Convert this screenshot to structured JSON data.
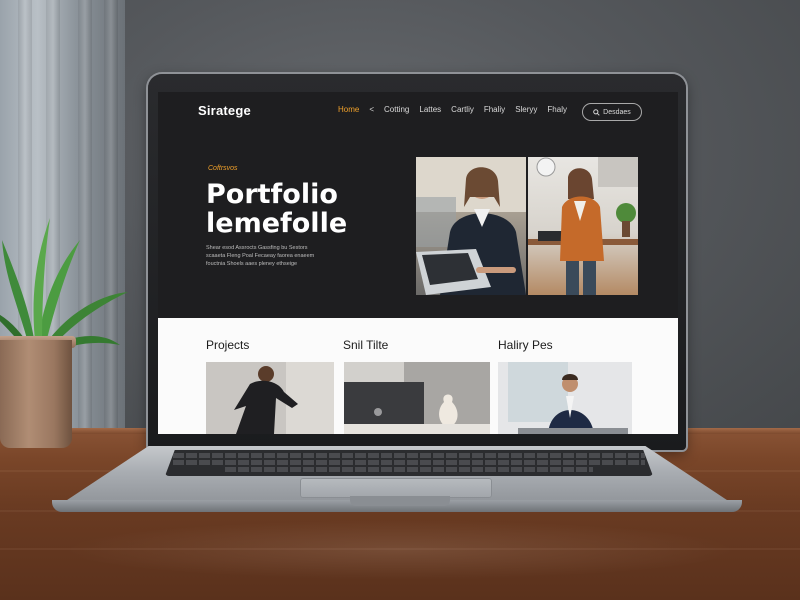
{
  "site": {
    "brand": "Siratege",
    "nav": [
      "Home",
      "<",
      "Cotting",
      "Lattes",
      "Cartliy",
      "Fhaliy",
      "Sleryy",
      "Fhaly"
    ],
    "nav_active_index": 0,
    "cta_label": "Desdaes",
    "cta_icon": "search-icon"
  },
  "hero": {
    "eyebrow": "Coftrsvos",
    "title_line1": "Portfolio",
    "title_line2": "lemefolle",
    "body_line1": "Shear esod Assrocts Gassfing bu Sestors",
    "body_line2": "scaaeta Fleng Poal Fecaeay faorea enaeem",
    "body_line3": "fouctnia Shoels aaes pleney ethseige"
  },
  "sections": [
    {
      "title": "Projects"
    },
    {
      "title": "Snil Tilte"
    },
    {
      "title": "Haliry Pes"
    }
  ],
  "colors": {
    "accent": "#f0a02a",
    "site_dark": "#1e1e20",
    "site_light": "#fbfbfb"
  }
}
